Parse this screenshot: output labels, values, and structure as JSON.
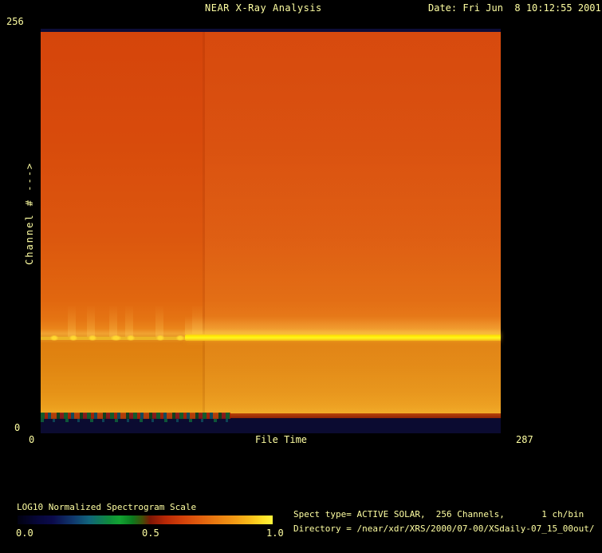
{
  "window": {
    "background": "#000000",
    "text_color": "#ffffa2"
  },
  "header": {
    "title": "NEAR X-Ray Analysis",
    "date": "Date: Fri Jun  8 10:12:55 2001"
  },
  "axes": {
    "y_max": "256",
    "y_min": "0",
    "y_label": "Channel # --->",
    "x_min": "0",
    "x_label": "File Time",
    "x_max": "287"
  },
  "colorbar": {
    "label": "LOG10 Normalized Spectrogram Scale",
    "tick_labels": [
      "0.0",
      "0.5",
      "1.0"
    ]
  },
  "footer": {
    "spect_info": "Spect type= ACTIVE SOLAR,  256 Channels,       1 ch/bin",
    "directory": "Directory = /near/xdr/XRS/2000/07-00/XSdaily-07_15_00out/"
  },
  "chart_data": {
    "type": "heatmap",
    "title": "NEAR X-Ray Analysis",
    "xlabel": "File Time",
    "ylabel": "Channel # --->",
    "xlim": [
      0,
      287
    ],
    "ylim": [
      0,
      256
    ],
    "x_ticks": [
      0,
      287
    ],
    "y_ticks": [
      0,
      256
    ],
    "grid": false,
    "legend_position": "none",
    "colorbar": {
      "label": "LOG10 Normalized Spectrogram Scale",
      "range": [
        0.0,
        1.0
      ],
      "ticks": [
        0.0,
        0.5,
        1.0
      ],
      "colormap_stops": [
        {
          "pos": 0.0,
          "color": "#010110"
        },
        {
          "pos": 0.1,
          "color": "#0a0a44"
        },
        {
          "pos": 0.2,
          "color": "#123c72"
        },
        {
          "pos": 0.28,
          "color": "#11647c"
        },
        {
          "pos": 0.38,
          "color": "#10973a"
        },
        {
          "pos": 0.45,
          "color": "#0c7a1e"
        },
        {
          "pos": 0.5,
          "color": "#5a3206"
        },
        {
          "pos": 0.54,
          "color": "#8c1a05"
        },
        {
          "pos": 0.62,
          "color": "#c83206"
        },
        {
          "pos": 0.72,
          "color": "#e05e0e"
        },
        {
          "pos": 0.84,
          "color": "#f09014"
        },
        {
          "pos": 0.94,
          "color": "#fcd01e"
        },
        {
          "pos": 1.0,
          "color": "#fff43c"
        }
      ]
    },
    "value_profile_by_channel": [
      {
        "channel_range": [
          254,
          256
        ],
        "value": 0.05,
        "note": "dark navy band at very top"
      },
      {
        "channel_range": [
          120,
          253
        ],
        "value": 0.7,
        "note": "uniform red-orange continuum"
      },
      {
        "channel_range": [
          70,
          119
        ],
        "value": 0.74,
        "note": "slightly brighter orange"
      },
      {
        "channel_range": [
          63,
          69
        ],
        "value": 0.8,
        "note": "amber halo above emission line"
      },
      {
        "channel_range": [
          60,
          62
        ],
        "value_file_0_90": 0.88,
        "value_file_90_287": 1.0,
        "note": "emission line: faint/intermittent before file ~90, saturated yellow after"
      },
      {
        "channel_range": [
          13,
          59
        ],
        "value": 0.78,
        "note": "amber-orange, brightening toward low channels"
      },
      {
        "channel_range": [
          10,
          12
        ],
        "value": 0.55,
        "note": "dark red edge; noisy green/teal/red speckle for file time 0-118"
      },
      {
        "channel_range": [
          0,
          9
        ],
        "value": 0.05,
        "note": "dark navy band at bottom"
      }
    ],
    "features": [
      {
        "name": "bright-emission-line",
        "channel": 61,
        "file_time_start": 90,
        "file_time_end": 287,
        "value": 1.0
      },
      {
        "name": "faint-emission-line",
        "channel": 61,
        "file_time_start": 0,
        "file_time_end": 90,
        "value": 0.88
      },
      {
        "name": "vertical-brightening-seam",
        "file_time": 102,
        "note": "right side of image slightly brighter than left"
      },
      {
        "name": "low-channel-noise-band",
        "channels": [
          8,
          13
        ],
        "file_time_start": 0,
        "file_time_end": 118
      }
    ]
  }
}
